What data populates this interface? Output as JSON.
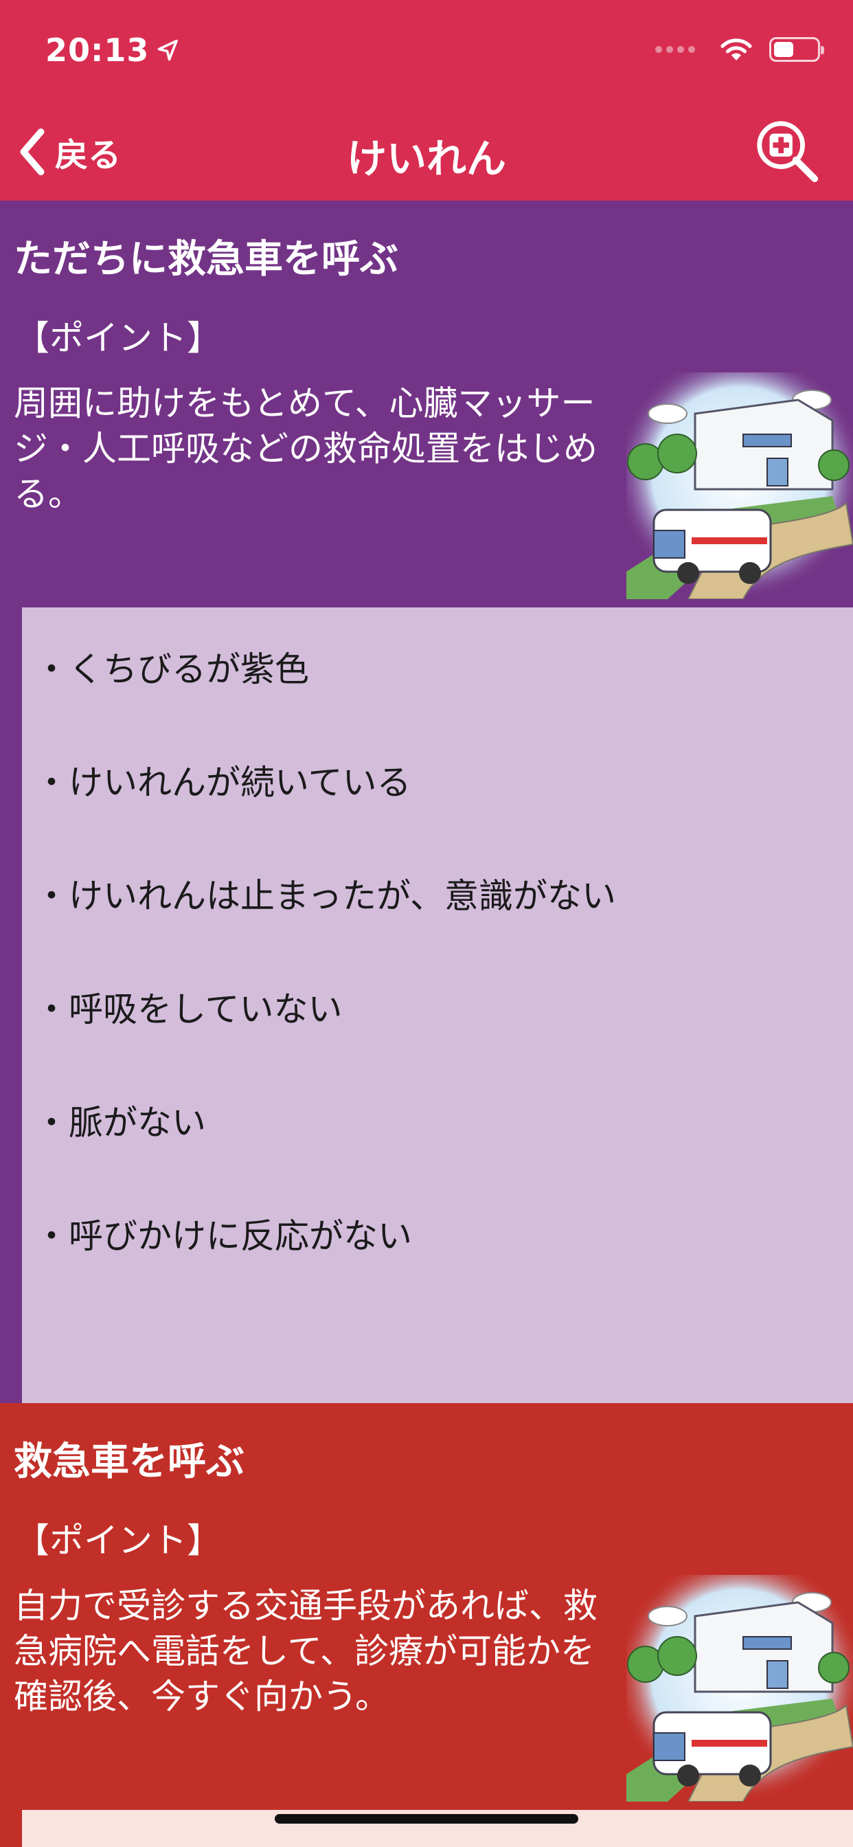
{
  "status_bar": {
    "time": "20:13",
    "battery_level": 0.45,
    "location-icon": "location-arrow-icon",
    "wifi-icon": "wifi-icon",
    "battery-icon": "battery-icon"
  },
  "nav": {
    "back_label": "戻る",
    "title": "けいれん",
    "search_icon": "zoom-medical-icon"
  },
  "colors": {
    "header": "#d82d51",
    "purple_section": "#733487",
    "purple_panel": "#d3bddb",
    "red_section": "#c22f28",
    "red_panel": "#fbe3df"
  },
  "sections": [
    {
      "title": "ただちに救急車を呼ぶ",
      "point_label": "【ポイント】",
      "description": "周囲に助けをもとめて、心臓マッサージ・人工呼吸などの救命処置をはじめる。",
      "symptoms": [
        "・くちびるが紫色",
        "・けいれんが続いている",
        "・けいれんは止まったが、意識がない",
        "・呼吸をしていない",
        "・脈がない",
        "・呼びかけに反応がない"
      ],
      "illustration": "hospital-ambulance-illustration"
    },
    {
      "title": "救急車を呼ぶ",
      "point_label": "【ポイント】",
      "description": "自力で受診する交通手段があれば、救急病院へ電話をして、診療が可能かを確認後、今すぐ向かう。",
      "illustration": "hospital-ambulance-illustration"
    }
  ]
}
